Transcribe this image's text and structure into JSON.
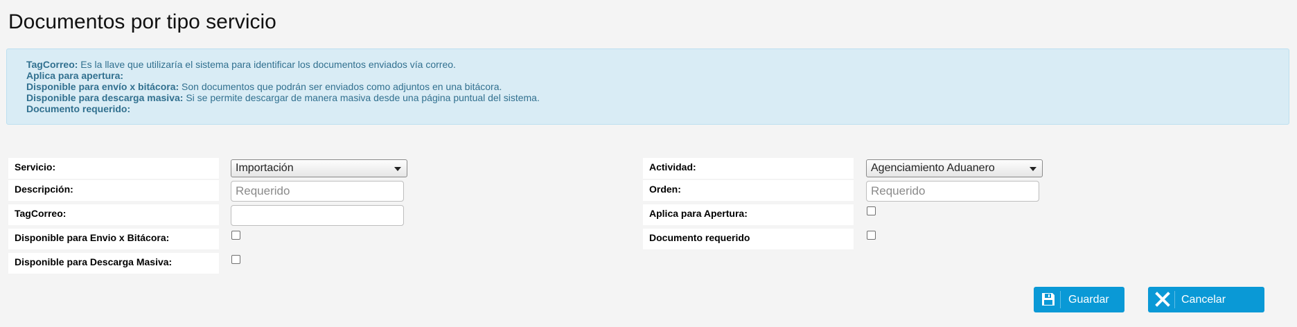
{
  "page": {
    "title": "Documentos por tipo servicio"
  },
  "info": {
    "lines": [
      {
        "term": "TagCorreo:",
        "desc": " Es la llave que utilizaría el sistema para identificar los documentos enviados vía correo."
      },
      {
        "term": "Aplica para apertura:",
        "desc": ""
      },
      {
        "term": "Disponible para envío x bitácora:",
        "desc": " Son documentos que podrán ser enviados como adjuntos en una bitácora."
      },
      {
        "term": "Disponible para descarga masiva:",
        "desc": " Si se permite descargar de manera masiva desde una página puntual del sistema."
      },
      {
        "term": "Documento requerido:",
        "desc": ""
      }
    ]
  },
  "form": {
    "servicio": {
      "label": "Servicio:",
      "value": "Importación"
    },
    "actividad": {
      "label": "Actividad:",
      "value": "Agenciamiento Aduanero"
    },
    "descripcion": {
      "label": "Descripción:",
      "placeholder": "Requerido"
    },
    "orden": {
      "label": "Orden:",
      "placeholder": "Requerido"
    },
    "tagcorreo": {
      "label": "TagCorreo:"
    },
    "aplica_apertura": {
      "label": "Aplica para Apertura:"
    },
    "envio_bitacora": {
      "label": "Disponible para Envio x Bitácora:"
    },
    "documento_requerido": {
      "label": "Documento requerido"
    },
    "descarga_masiva": {
      "label": "Disponible para Descarga Masiva:"
    }
  },
  "buttons": {
    "save_label": "Guardar",
    "cancel_label": "Cancelar"
  },
  "icons": {
    "save": "floppy-disk-icon",
    "cancel": "close-x-icon"
  },
  "colors": {
    "primary_button": "#0a99d6",
    "info_background": "#d9ecf5",
    "info_text": "#31708f"
  }
}
